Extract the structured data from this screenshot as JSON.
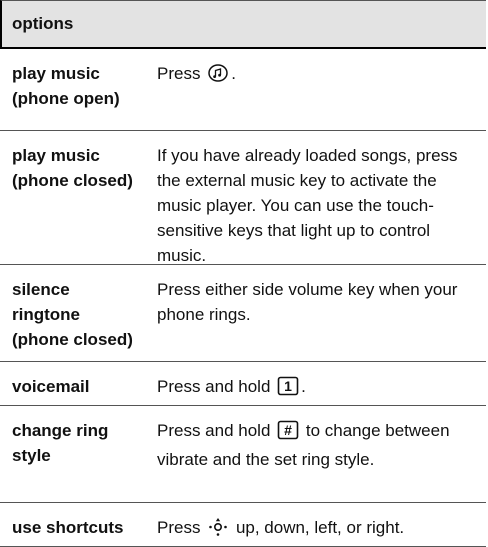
{
  "header": {
    "label": "options"
  },
  "rows": [
    {
      "name": "play music\n(phone open)",
      "desc_before": "Press",
      "icon": "music-key-icon",
      "desc_after": "."
    },
    {
      "name": "play music\n(phone closed)",
      "desc": "If you have already loaded songs, press the external music key to activate the music player. You can use the touch-sensitive keys that light up to control music."
    },
    {
      "name": "silence\nringtone\n(phone closed)",
      "desc": "Press either side volume key when your phone rings."
    },
    {
      "name": "voicemail",
      "desc_before": "Press and hold",
      "icon": "key-1-icon",
      "desc_after": "."
    },
    {
      "name": "change ring\nstyle",
      "desc_before": "Press and hold",
      "icon": "key-hash-icon",
      "desc_after": "to change between vibrate and the set ring style."
    },
    {
      "name": "use shortcuts",
      "desc_before": "Press",
      "icon": "nav-key-icon",
      "desc_after": "up, down, left, or right."
    }
  ]
}
